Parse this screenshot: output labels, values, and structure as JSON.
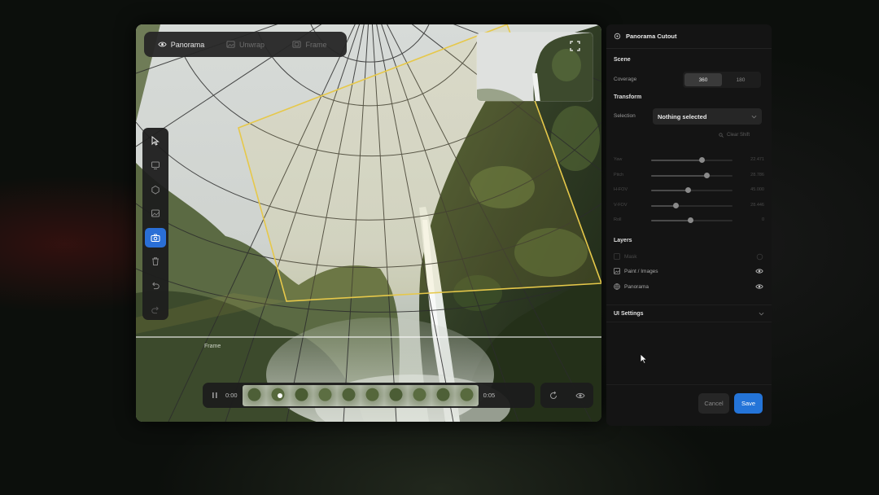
{
  "viewer": {
    "tabs": [
      {
        "label": "Panorama",
        "icon": "eye-icon",
        "active": true
      },
      {
        "label": "Unwrap",
        "icon": "image-icon",
        "active": false
      },
      {
        "label": "Frame",
        "icon": "frame-icon",
        "active": false
      }
    ],
    "tools": [
      {
        "icon": "pointer-icon",
        "active": false
      },
      {
        "icon": "monitor-icon",
        "active": false
      },
      {
        "icon": "circle-icon",
        "active": false
      },
      {
        "icon": "image-icon",
        "active": false
      },
      {
        "icon": "camera-icon",
        "active": true
      },
      {
        "icon": "trash-icon",
        "active": false
      },
      {
        "icon": "undo-icon",
        "active": false
      },
      {
        "icon": "redo-icon",
        "active": false
      }
    ],
    "frame_label": "Frame",
    "timeline": {
      "start_time": "0:00",
      "end_time": "0:05",
      "progress": 0.15
    },
    "colors": {
      "accent": "#2474d8",
      "selection": "#e6c84a"
    }
  },
  "panel": {
    "title": "Panorama Cutout",
    "scene": {
      "heading": "Scene",
      "coverage_label": "Coverage",
      "coverage_options": [
        "360",
        "180"
      ],
      "coverage_selected": "360"
    },
    "transform": {
      "heading": "Transform",
      "selection_label": "Selection",
      "selection_value": "Nothing selected",
      "clear_label": "Clear Shift"
    },
    "sliders": [
      {
        "label": "Yaw",
        "value": "22.471",
        "level": 0.62
      },
      {
        "label": "Pitch",
        "value": "28.786",
        "level": 0.68
      },
      {
        "label": "H-FOV",
        "value": "45.000",
        "level": 0.45
      },
      {
        "label": "V-FOV",
        "value": "28.446",
        "level": 0.3
      },
      {
        "label": "Roll",
        "value": "0",
        "level": 0.48
      }
    ],
    "layers": {
      "heading": "Layers",
      "items": [
        {
          "label": "Mask",
          "icon": "mask-icon",
          "dim": true
        },
        {
          "label": "Paint / Images",
          "icon": "image-icon",
          "dim": false
        },
        {
          "label": "Panorama",
          "icon": "globe-icon",
          "dim": false
        }
      ]
    },
    "ui_settings": "UI Settings",
    "cancel_label": "Cancel",
    "save_label": "Save"
  }
}
